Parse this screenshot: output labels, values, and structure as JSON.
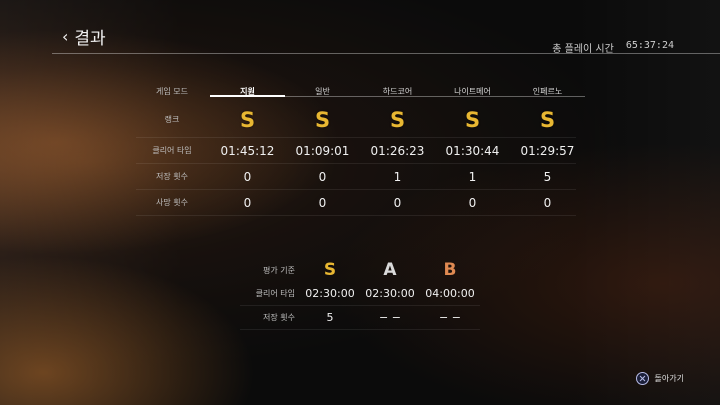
{
  "header": {
    "back_label": "결과",
    "playtime_label": "총 플레이 시간",
    "playtime_value": "65:37:24"
  },
  "results": {
    "row_labels": {
      "mode": "게임 모드",
      "rank": "랭크",
      "clear_time": "클리어 타임",
      "saves": "저장 횟수",
      "deaths": "사망 횟수"
    },
    "modes": [
      "지원",
      "일반",
      "하드코어",
      "나이트메어",
      "인페르노"
    ],
    "selected_mode_index": 0,
    "ranks": [
      "S",
      "S",
      "S",
      "S",
      "S"
    ],
    "clear_times": [
      "01:45:12",
      "01:09:01",
      "01:26:23",
      "01:30:44",
      "01:29:57"
    ],
    "saves": [
      "0",
      "0",
      "1",
      "1",
      "5"
    ],
    "deaths": [
      "0",
      "0",
      "0",
      "0",
      "0"
    ]
  },
  "criteria": {
    "title": "평가 기준",
    "clear_time_label": "클리어 타임",
    "saves_label": "저장 횟수",
    "grades": [
      "S",
      "A",
      "B"
    ],
    "grade_colors": [
      "#e8b732",
      "#d9d9d9",
      "#e08a52"
    ],
    "clear_times": [
      "02:30:00",
      "02:30:00",
      "04:00:00"
    ],
    "saves": [
      "5",
      "− −",
      "− −"
    ]
  },
  "footer": {
    "back_label": "돌아가기"
  },
  "colors": {
    "rank": "#e8b732",
    "accent_line": "#ffffff"
  }
}
